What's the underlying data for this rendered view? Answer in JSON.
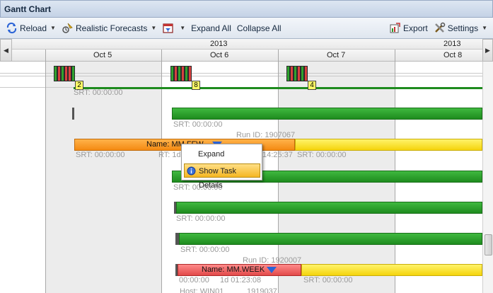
{
  "window": {
    "title": "Gantt Chart"
  },
  "toolbar": {
    "reload_label": "Reload",
    "forecasts_label": "Realistic Forecasts",
    "expand_all_label": "Expand All",
    "collapse_all_label": "Collapse All",
    "export_label": "Export",
    "settings_label": "Settings",
    "icons": [
      "reload-icon",
      "forecast-icon",
      "filter-calendar-icon",
      "export-icon",
      "settings-icon"
    ]
  },
  "timeline": {
    "year_left": "2013",
    "year_right": "2013",
    "days": [
      "Oct 5",
      "Oct 6",
      "Oct 7",
      "Oct 8"
    ]
  },
  "summary": {
    "badges": [
      "2",
      "8",
      "4"
    ],
    "srt": "SRT: 00:00:00"
  },
  "rows": {
    "r1_srt": "SRT: 00:00:00",
    "r2_runid": "Run ID: 1907067",
    "r2_name": "Name: MM.FFW",
    "r2_srt": "SRT: 00:00:00",
    "r2_rt": "RT: 1d",
    "r2_time": "14:25:37",
    "r2_srt2": "SRT: 00:00:00",
    "r3_srt": "SRT: 00:00:00",
    "r4_srt": "SRT: 00:00:00",
    "r5_srt": "SRT: 00:00:00",
    "r6_runid": "Run ID: 1920007",
    "r6_name": "Name: MM.WEEK",
    "r6_start": "00:00:00",
    "r6_duration": "1d 01:23:08",
    "r6_srt": "SRT: 00:00:00",
    "r6_host": "Host: WIN01",
    "r6_num": "1919037"
  },
  "context_menu": {
    "expand_label": "Expand",
    "details_label": "Show Task Details"
  },
  "colors": {
    "bar_green": "#1e8b1e",
    "bar_orange": "#f48a12",
    "bar_yellow": "#f5d40c",
    "bar_red": "#e24a4a",
    "menu_highlight": "#f5b622"
  }
}
